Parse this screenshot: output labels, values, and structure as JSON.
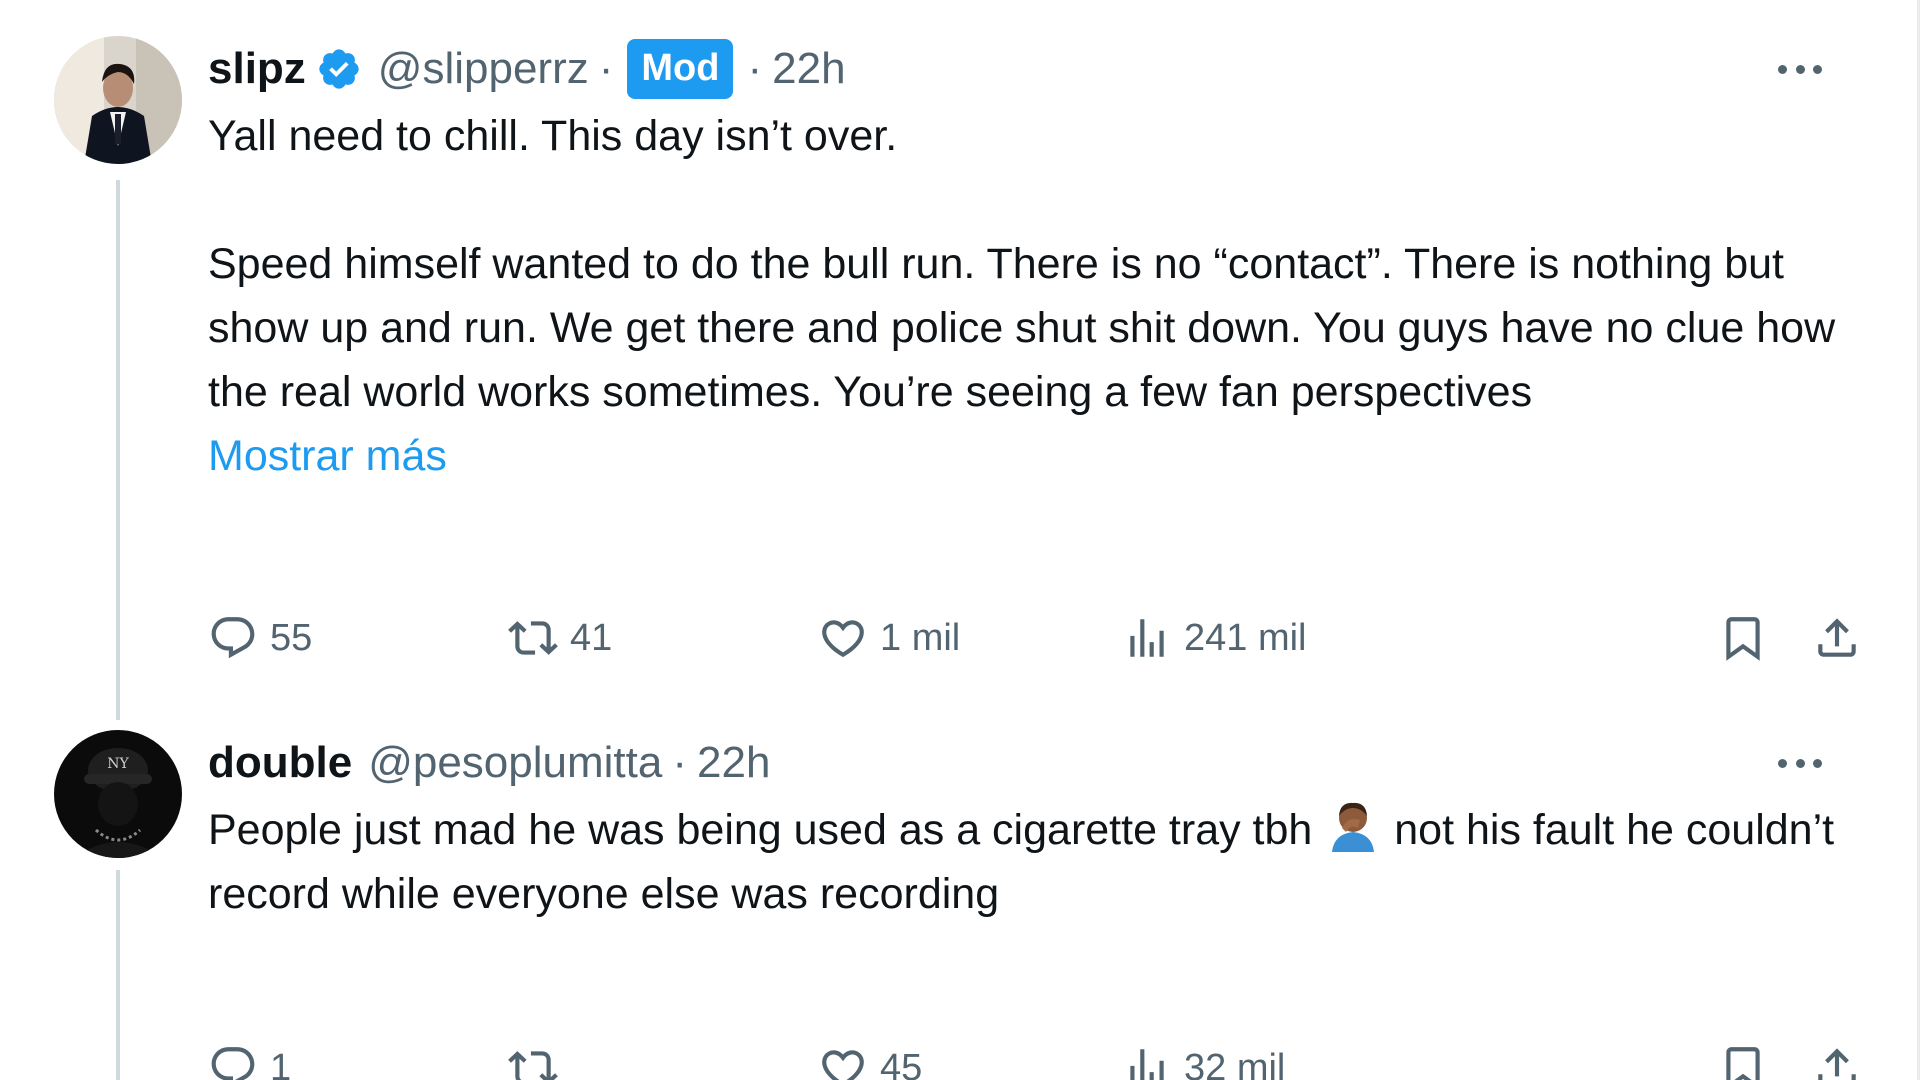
{
  "tweets": [
    {
      "display_name": "slipz",
      "verified": true,
      "handle": "@slipperrz",
      "separator": "·",
      "badge": "Mod",
      "time": "22h",
      "text_line1": "Yall need to chill. This day isn’t over.",
      "text_para2": "Speed himself wanted to do the bull run. There is no “contact”. There is nothing but show up and run. We get there and police shut shit down. You guys have no clue how the real world works sometimes. You’re seeing a few fan perspectives",
      "show_more": "Mostrar más",
      "replies": "55",
      "reposts": "41",
      "likes": "1 mil",
      "views": "241 mil"
    },
    {
      "display_name": "double",
      "handle": "@pesoplumitta",
      "separator": "·",
      "time": "22h",
      "text_before_emoji": "People just mad he was being used as a cigarette tray tbh",
      "emoji_icon": "person-facepalming-emoji",
      "text_after_emoji": "not his fault he couldn’t record while everyone else was recording",
      "replies": "1",
      "reposts": "",
      "likes": "45",
      "views": "32 mil"
    }
  ],
  "colors": {
    "accent": "#1d9bf0",
    "text": "#0f1419",
    "muted": "#536471",
    "thread_line": "#cfd9de"
  }
}
